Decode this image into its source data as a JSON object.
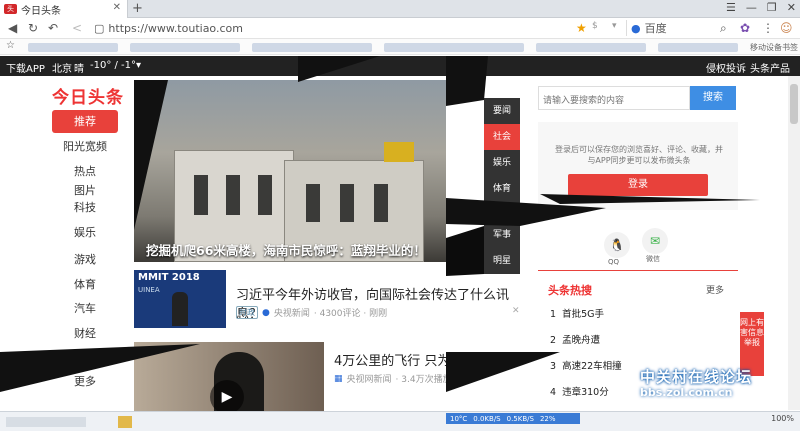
{
  "browser": {
    "tab_title": "今日头条",
    "tab_favicon": "头条",
    "url": "https://www.toutiao.com",
    "search_engine": "百度",
    "bookmark_trailing": "移动设备书签"
  },
  "sitebar": {
    "download": "下载APP",
    "city": "北京",
    "weather": "晴",
    "temp": "-10° / -1°",
    "report": "侵权投诉",
    "products": "头条产品"
  },
  "logo": "今日头条",
  "nav": [
    {
      "label": "推荐",
      "active": true
    },
    {
      "label": "阳光宽频"
    },
    {
      "label": "热点"
    },
    {
      "label": "图片"
    },
    {
      "label": "科技"
    },
    {
      "label": "娱乐"
    },
    {
      "label": "游戏"
    },
    {
      "label": "体育"
    },
    {
      "label": "汽车"
    },
    {
      "label": "财经"
    },
    {
      "label": "更多"
    }
  ],
  "hero": {
    "title": "挖掘机爬66米高楼，海南市民惊呼：蓝翔毕业的！",
    "side_tabs": [
      "要闻",
      "社会",
      "娱乐",
      "体育"
    ],
    "side_tabs2": [
      "军事",
      "明星"
    ]
  },
  "articles": [
    {
      "title": "习近平今年外访收官，向国际社会传达了什么讯息？",
      "tag": "时政",
      "source": "央视新闻",
      "meta": "· 4300评论 · 刚刚",
      "thumb_text": "MMIT 2018",
      "thumb_sub": "UINEA"
    },
    {
      "title": "4万公里的飞行 只为遇见",
      "source": "央视网新闻",
      "meta": "· 3.4万次播放"
    }
  ],
  "right": {
    "search_placeholder": "请输入要搜索的内容",
    "search_button": "搜索",
    "login_desc": "登录后可以保存您的浏览喜好、评论、收藏，并与APP同步更可以发布微头条",
    "login_button": "登录",
    "social": [
      "QQ",
      "微信"
    ],
    "hot_title": "头条热搜",
    "hot_more": "更多",
    "hot_items": [
      {
        "rank": "1",
        "text": "首批5G手"
      },
      {
        "rank": "2",
        "text": "孟晚舟遭"
      },
      {
        "rank": "3",
        "text": "高速22车相撞"
      },
      {
        "rank": "4",
        "text": "违章310分"
      }
    ]
  },
  "side_ad": "网上有害信息举报",
  "watermark": {
    "title": "中关村在线论坛",
    "url": "bbs.zol.com.cn"
  },
  "taskbar": {
    "temp": "10°C",
    "down": "0.0KB/S",
    "up": "0.5KB/S",
    "percent": "22%",
    "zoom": "100%"
  },
  "colors": {
    "brand": "#e8413b",
    "search": "#3e8ee4",
    "dark": "#222222"
  }
}
